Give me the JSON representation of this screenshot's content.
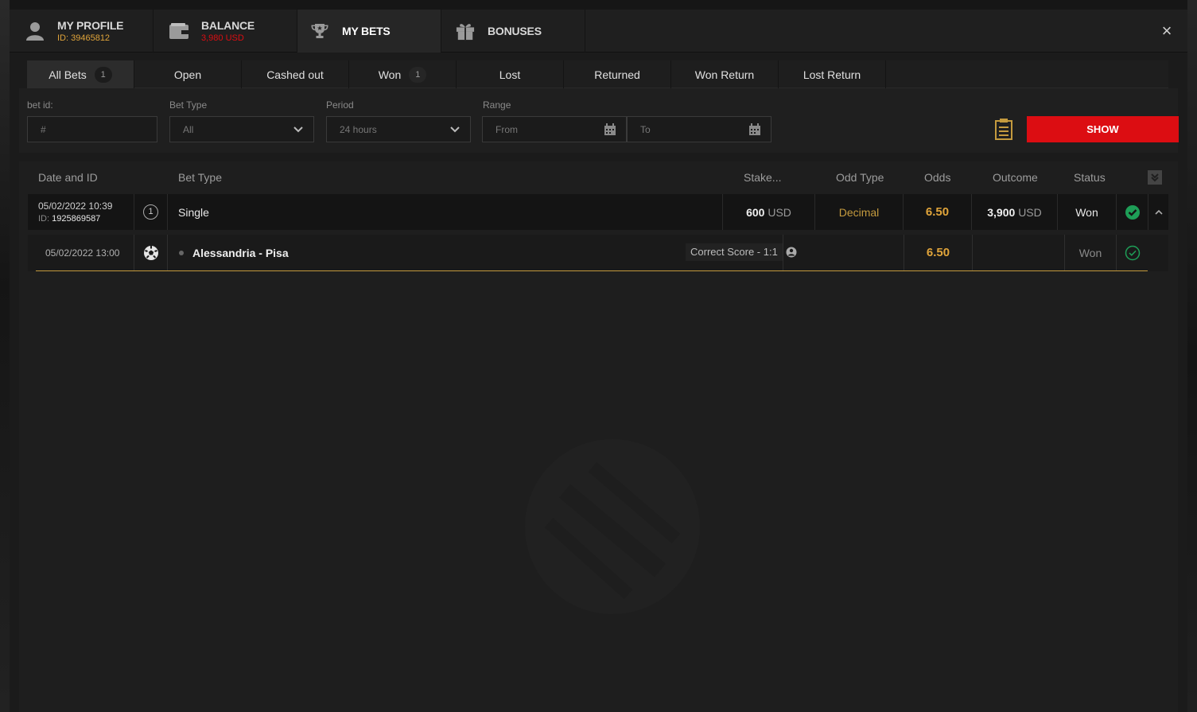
{
  "header": {
    "tabs": [
      {
        "title": "MY PROFILE",
        "subtitle": "ID: 39465812",
        "icon": "user-icon",
        "subtitle_color": "#e0a43a"
      },
      {
        "title": "BALANCE",
        "subtitle": "3,980 USD",
        "icon": "wallet-icon",
        "subtitle_color": "#dc0d12"
      },
      {
        "title": "MY BETS",
        "subtitle": "",
        "icon": "trophy-icon"
      },
      {
        "title": "BONUSES",
        "subtitle": "",
        "icon": "gift-icon"
      }
    ],
    "close_label": "×"
  },
  "filter_tabs": [
    {
      "label": "All Bets",
      "count": "1",
      "active": true
    },
    {
      "label": "Open",
      "count": ""
    },
    {
      "label": "Cashed out",
      "count": ""
    },
    {
      "label": "Won",
      "count": "1"
    },
    {
      "label": "Lost",
      "count": ""
    },
    {
      "label": "Returned",
      "count": ""
    },
    {
      "label": "Won Return",
      "count": ""
    },
    {
      "label": "Lost Return",
      "count": ""
    }
  ],
  "filters": {
    "bet_id": {
      "label": "bet id:",
      "placeholder": "#"
    },
    "bet_type": {
      "label": "Bet Type",
      "value": "All"
    },
    "period": {
      "label": "Period",
      "value": "24 hours"
    },
    "range": {
      "label": "Range",
      "from": "From",
      "to": "To"
    },
    "show_label": "SHOW"
  },
  "table": {
    "columns": {
      "date_id": "Date and ID",
      "bet_type": "Bet Type",
      "stake": "Stake...",
      "odd_type": "Odd Type",
      "odds": "Odds",
      "outcome": "Outcome",
      "status": "Status"
    },
    "bet": {
      "date": "05/02/2022 10:39",
      "id_label": "ID:",
      "id": "1925869587",
      "count_badge": "1",
      "bet_type": "Single",
      "stake_amount": "600",
      "stake_currency": "USD",
      "odd_type": "Decimal",
      "odds": "6.50",
      "outcome_amount": "3,900",
      "outcome_currency": "USD",
      "status": "Won"
    },
    "selection": {
      "date": "05/02/2022 13:00",
      "event": "Alessandria - Pisa",
      "market": "Correct Score - 1:1",
      "odds": "6.50",
      "status": "Won"
    }
  },
  "colors": {
    "accent_gold": "#e0a43a",
    "show_red": "#dc0d12",
    "won_green": "#1e9e57"
  }
}
